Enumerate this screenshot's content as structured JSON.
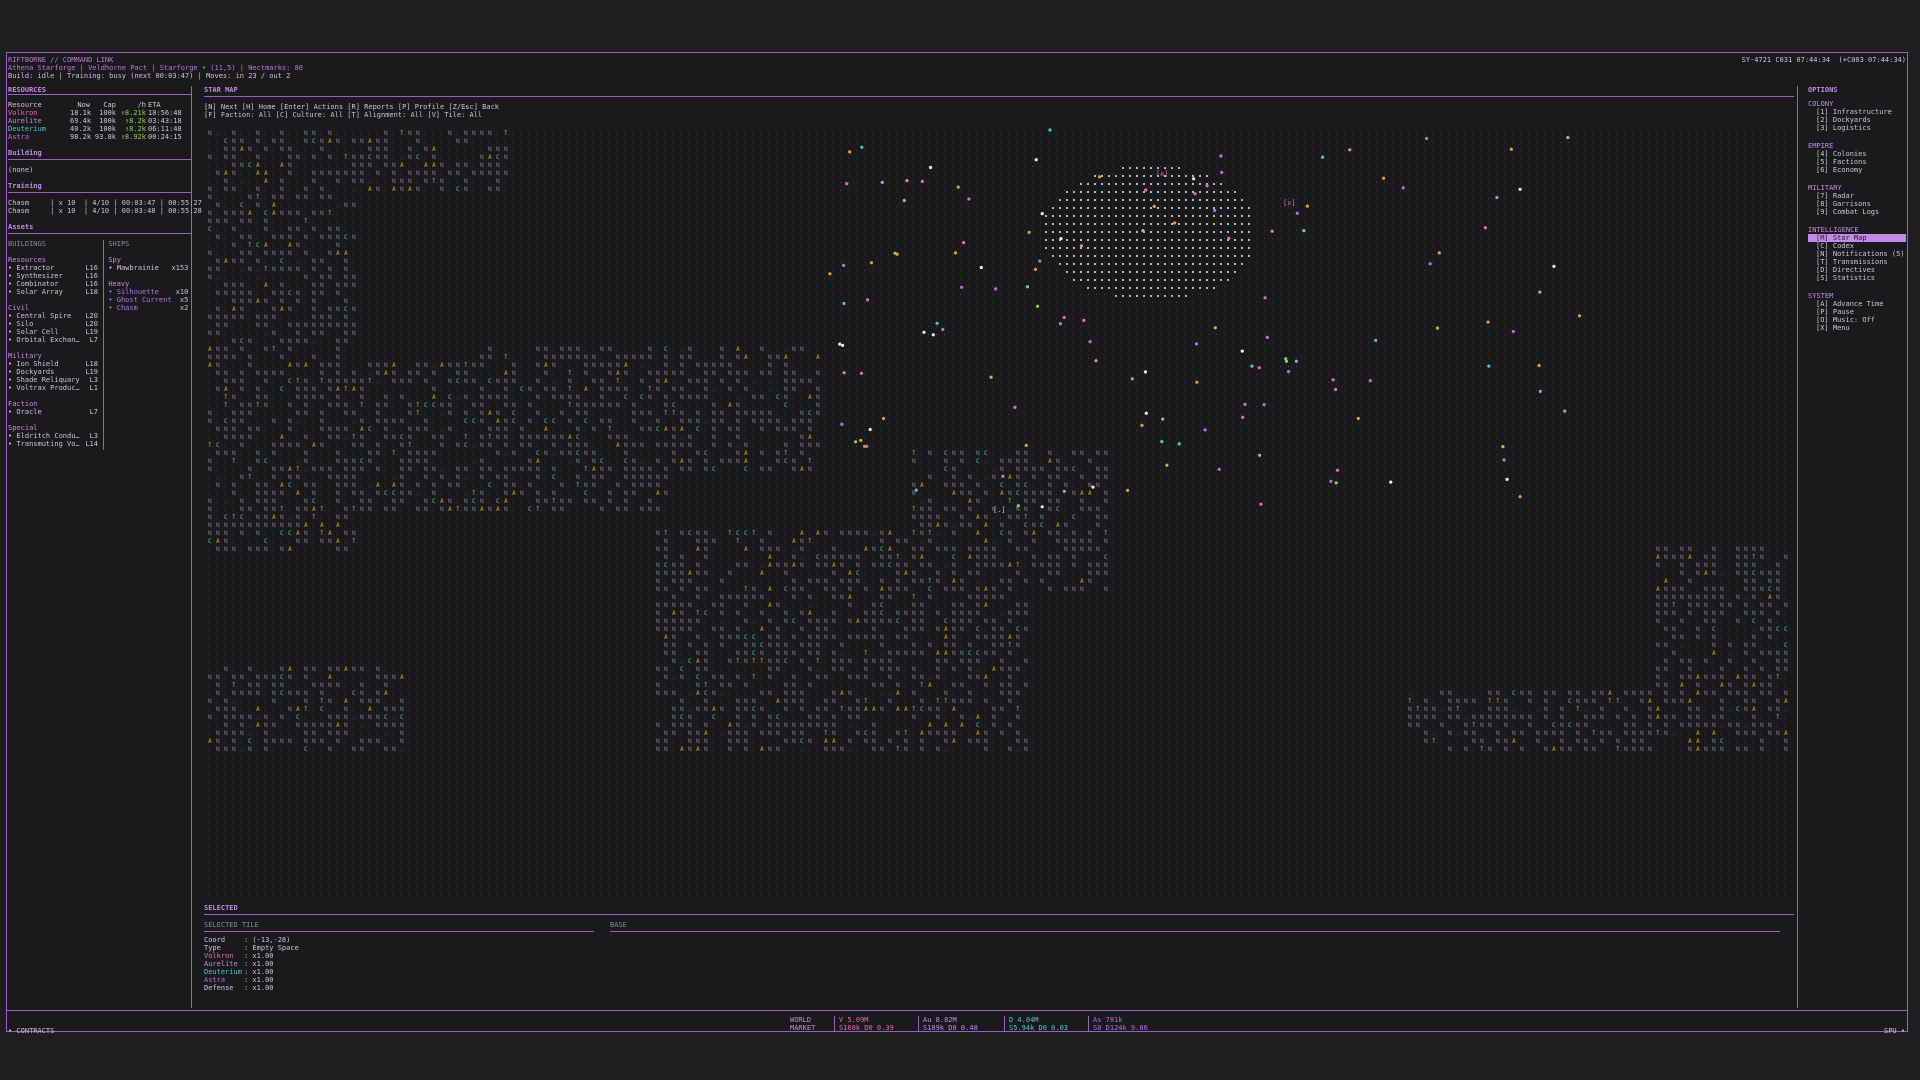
{
  "header": {
    "title": "RIFTBORNE // COMMAND LINK",
    "subtitle": "Athena Starforge | Veldhorne Pact | Starforge • (11,5) | Nectmarks: 80",
    "build_line": "Build: idle | Training: busy (next 00:03:47) | Moves: in 23 / out 2",
    "clock": "SY-4721 C031 07:44:34  (+C003 07:44:34)"
  },
  "resources": {
    "title": "RESOURCES",
    "columns": [
      "Resource",
      "Now",
      "Cap",
      "/h",
      "ETA"
    ],
    "rows": [
      {
        "name": "Volkron",
        "now": "18.1k",
        "cap": "100k",
        "rate": "↑8.21k",
        "eta": "10:56:48"
      },
      {
        "name": "Aurelite",
        "now": "69.4k",
        "cap": "100k",
        "rate": "↑8.2k",
        "eta": "03:43:18"
      },
      {
        "name": "Deuterium",
        "now": "40.2k",
        "cap": "100k",
        "rate": "↑8.2k",
        "eta": "06:11:48"
      },
      {
        "name": "Astra",
        "now": "98.2k",
        "cap": "93.8k",
        "rate": "↑8.92k",
        "eta": "00:24:15"
      }
    ]
  },
  "building": {
    "title": "Building",
    "value": "(none)"
  },
  "training": {
    "title": "Training",
    "rows": [
      "Chasm     | x 10  | 4/10 | 00:03:47 | 00:55:27",
      "Chasm     | x 10  | 4/10 | 00:03:48 | 00:55:28"
    ]
  },
  "assets": {
    "title": "Assets",
    "buildings_title": "BUILDINGS",
    "ships_title": "SHIPS",
    "groups": [
      {
        "name": "Resources",
        "items": [
          [
            "• Extractor",
            "L16"
          ],
          [
            "• Synthesizer",
            "L16"
          ],
          [
            "• Combinator",
            "L16"
          ],
          [
            "• Solar Array",
            "L18"
          ]
        ]
      },
      {
        "name": "Civil",
        "items": [
          [
            "• Central Spire",
            "L20"
          ],
          [
            "• Silo",
            "L20"
          ],
          [
            "• Solar Cell",
            "L19"
          ],
          [
            "• Orbital Exchan…",
            "L7"
          ]
        ]
      },
      {
        "name": "Military",
        "items": [
          [
            "• Ion Shield",
            "L18"
          ],
          [
            "• Dockyards",
            "L19"
          ],
          [
            "• Shade Reliquary",
            "L3"
          ],
          [
            "• Voltrax Produc…",
            "L1"
          ]
        ]
      },
      {
        "name": "Faction",
        "items": [
          [
            "• Oracle",
            "L7"
          ]
        ]
      },
      {
        "name": "Special",
        "items": [
          [
            "• Eldritch Condu…",
            "L3"
          ],
          [
            "• Transmuting Vo…",
            "L14"
          ]
        ]
      }
    ],
    "ship_groups": [
      {
        "name": "Spy",
        "items": [
          [
            "• Mawbrainie",
            "x153"
          ]
        ]
      },
      {
        "name": "Heavy",
        "items": [
          [
            "• Silhouette",
            "x10"
          ],
          [
            "• Ghost Current",
            "x5"
          ],
          [
            "• Chasm",
            "x2"
          ]
        ]
      }
    ]
  },
  "starmap": {
    "title": "STAR MAP",
    "help1": "[N] Next [H] Home [Enter] Actions [R] Reports [P] Profile [Z/Esc] Back",
    "help2": "[F] Faction: All [C] Culture: All [T] Alignment: All [V] Tile: All",
    "cursor_marker": "[x]",
    "cursor_marker_2": "[x]",
    "selector": "[.]"
  },
  "selected": {
    "title": "SELECTED",
    "tile_title": "SELECTED TILE",
    "base_title": "BASE",
    "lines": [
      {
        "label": "Coord",
        "value": ": (-13,-28)",
        "cls": ""
      },
      {
        "label": "Type",
        "value": ": Empty Space",
        "cls": ""
      },
      {
        "label": "Volkron",
        "value": ": x1.00",
        "cls": "pink"
      },
      {
        "label": "Aurelite",
        "value": ": x1.00",
        "cls": "k"
      },
      {
        "label": "Deuterium",
        "value": ": x1.00",
        "cls": "cyan"
      },
      {
        "label": "Astra",
        "value": ": x1.00",
        "cls": "violet"
      },
      {
        "label": "Defense",
        "value": ": x1.00",
        "cls": ""
      }
    ]
  },
  "options": {
    "title": "OPTIONS",
    "groups": [
      {
        "name": "COLONY",
        "items": [
          "[1] Infrastructure",
          "[2] Dockyards",
          "[3] Logistics"
        ]
      },
      {
        "name": "EMPIRE",
        "items": [
          "[4] Colonies",
          "[5] Factions",
          "[6] Economy"
        ]
      },
      {
        "name": "MILITARY",
        "items": [
          "[7] Radar",
          "[8] Garrisons",
          "[9] Combat Logs"
        ]
      },
      {
        "name": "INTELLIGENCE",
        "items": [
          "[M] Star Map",
          "[C] Codex",
          "[N] Notifications (5)",
          "[T] Transmissions",
          "[D] Directives",
          "[S] Statistics"
        ],
        "active": 0
      },
      {
        "name": "SYSTEM",
        "items": [
          "[A] Advance Time",
          "[P] Pause",
          "[O] Music: Off",
          "[X] Menu"
        ]
      }
    ]
  },
  "footer": {
    "contracts": "• CONTRACTS",
    "world": "WORLD",
    "market": "MARKET",
    "m1a": "V 5.09M",
    "m1b": "S160k D0 0.39",
    "m2a": "Au 8.82M",
    "m2b": "S189k D0 0.48",
    "m3a": "D 4.04M",
    "m3b": "S5.94k D0 0.03",
    "m4a": "As 781k",
    "m4b": "S0 D124k 9.86",
    "right": "SPU •"
  },
  "colors": {
    "accent": "#c58ae8",
    "border": "#9a5fc0",
    "volkron": "#e26fae",
    "aurelite": "#c58ae8",
    "deuterium": "#4fc7cf",
    "astra": "#b46fe6"
  }
}
